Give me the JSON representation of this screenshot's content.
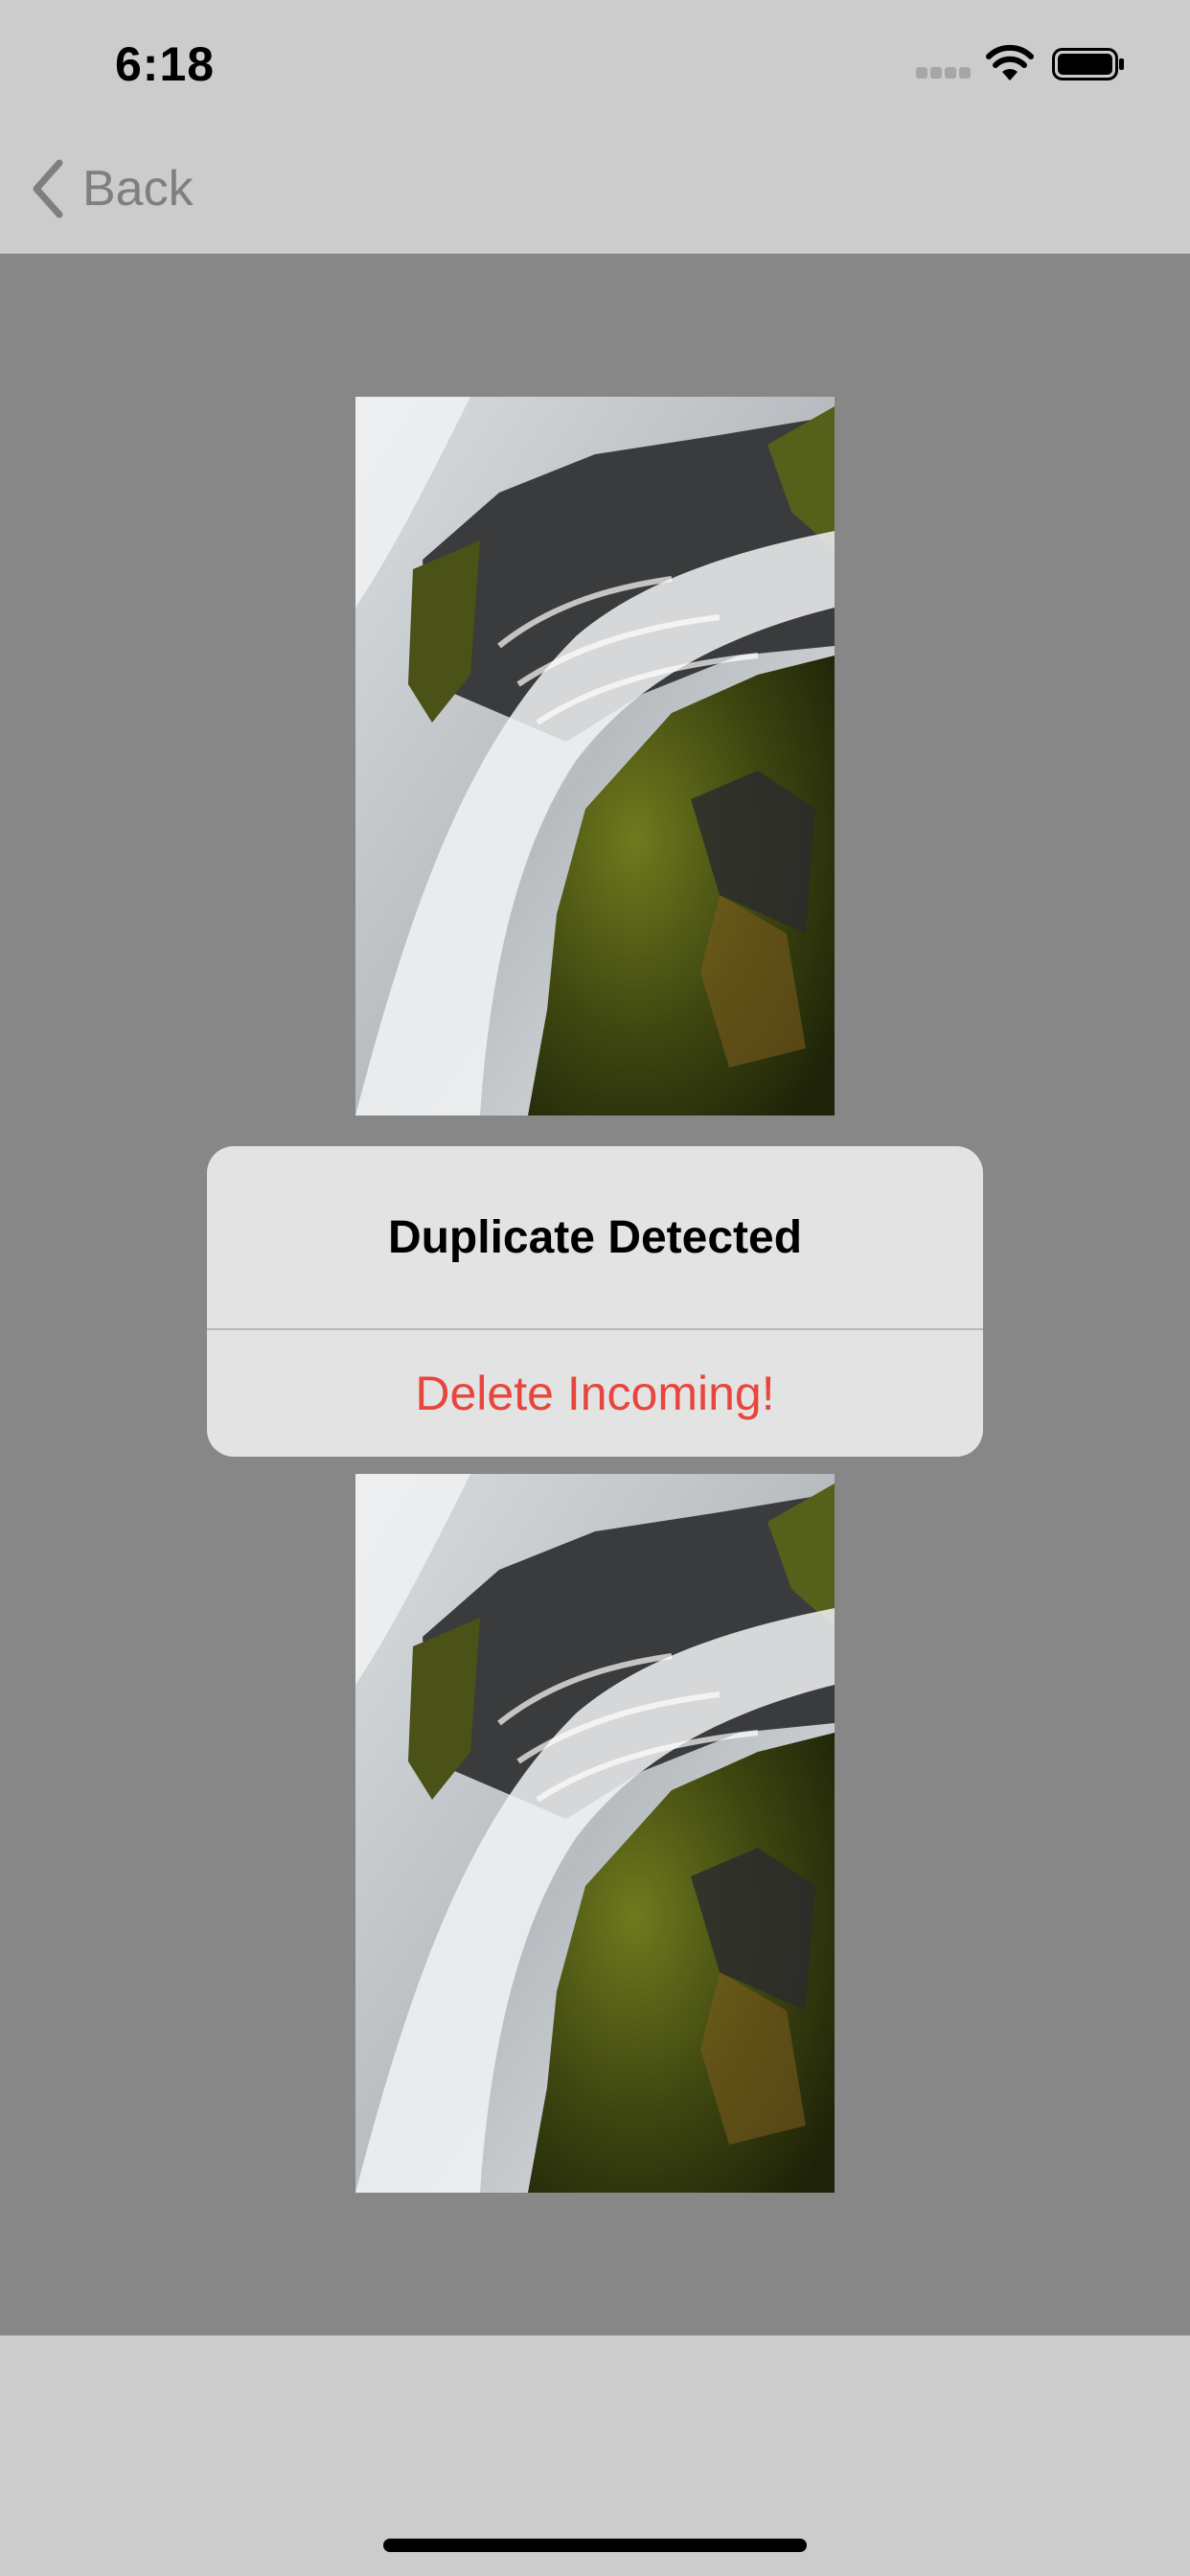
{
  "status_bar": {
    "time": "6:18",
    "icons": [
      "cellular-signal-icon",
      "wifi-icon",
      "battery-icon"
    ]
  },
  "nav": {
    "back_label": "Back",
    "back_icon": "chevron-left-icon"
  },
  "images": [
    {
      "subject": "waterfall-over-mossy-rocks"
    },
    {
      "subject": "waterfall-over-mossy-rocks"
    }
  ],
  "alert": {
    "title": "Duplicate Detected",
    "action_label": "Delete Incoming!"
  },
  "colors": {
    "background_overlay": "#878787",
    "bars": "#cccccc",
    "alert_background": "#e3e3e3",
    "destructive": "#e8453c",
    "back_tint": "#7f7f7f"
  }
}
